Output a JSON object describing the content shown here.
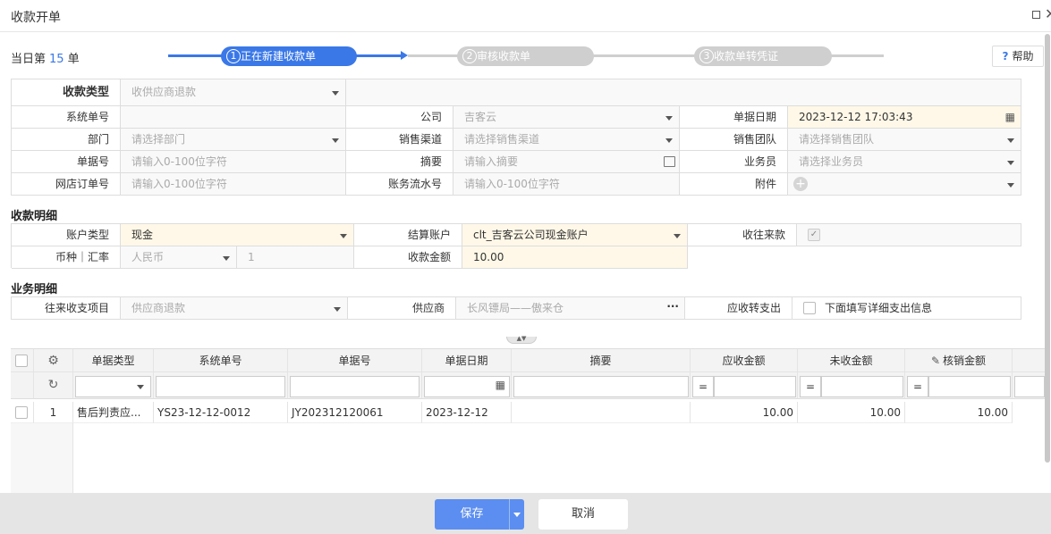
{
  "window": {
    "title": "收款开单"
  },
  "header": {
    "today_prefix": "当日第",
    "today_count": "15",
    "today_suffix": "单",
    "steps": [
      {
        "num": "1",
        "label": "正在新建收款单"
      },
      {
        "num": "2",
        "label": "审核收款单"
      },
      {
        "num": "3",
        "label": "收款单转凭证"
      }
    ],
    "help_label": "帮助"
  },
  "basic": {
    "type_label": "收款类型",
    "type_value": "收供应商退款",
    "sysno_label": "系统单号",
    "company_label": "公司",
    "company_value": "吉客云",
    "date_label": "单据日期",
    "date_value": "2023-12-12 17:03:43",
    "dept_label": "部门",
    "dept_placeholder": "请选择部门",
    "channel_label": "销售渠道",
    "channel_placeholder": "请选择销售渠道",
    "team_label": "销售团队",
    "team_placeholder": "请选择销售团队",
    "billno_label": "单据号",
    "billno_placeholder": "请输入0-100位字符",
    "summary_label": "摘要",
    "summary_placeholder": "请输入摘要",
    "salesman_label": "业务员",
    "salesman_placeholder": "请选择业务员",
    "shoporder_label": "网店订单号",
    "shoporder_placeholder": "请输入0-100位字符",
    "flowno_label": "账务流水号",
    "flowno_placeholder": "请输入0-100位字符",
    "attach_label": "附件"
  },
  "receipt": {
    "section_title": "收款明细",
    "acct_type_label": "账户类型",
    "acct_type_value": "现金",
    "settle_label": "结算账户",
    "settle_value": "clt_吉客云公司现金账户",
    "income_label": "收往来款",
    "currency_label": "币种｜汇率",
    "currency_value": "人民币",
    "rate_value": "1",
    "amount_label": "收款金额",
    "amount_value": "10.00"
  },
  "business": {
    "section_title": "业务明细",
    "item_label": "往来收支项目",
    "item_value": "供应商退款",
    "supplier_label": "供应商",
    "supplier_value": "长风镖局——傲来仓",
    "transfer_label": "应收转支出",
    "transfer_check_label": "下面填写详细支出信息"
  },
  "table": {
    "headers": [
      "单据类型",
      "系统单号",
      "单据号",
      "单据日期",
      "摘要",
      "应收金额",
      "未收金额",
      "核销金额"
    ],
    "eq_sign": "=",
    "rows": [
      {
        "idx": "1",
        "type": "售后判责应...",
        "sysno": "YS23-12-12-0012",
        "billno": "JY202312120061",
        "date": "2023-12-12",
        "summary": "",
        "receivable": "10.00",
        "unreceived": "10.00",
        "writeoff": "10.00"
      }
    ]
  },
  "footer": {
    "save_label": "保存",
    "cancel_label": "取消"
  },
  "colors": {
    "primary": "#3b78e7",
    "step_inactive": "#cfcfcf",
    "highlight_bg": "#fff8e8"
  }
}
